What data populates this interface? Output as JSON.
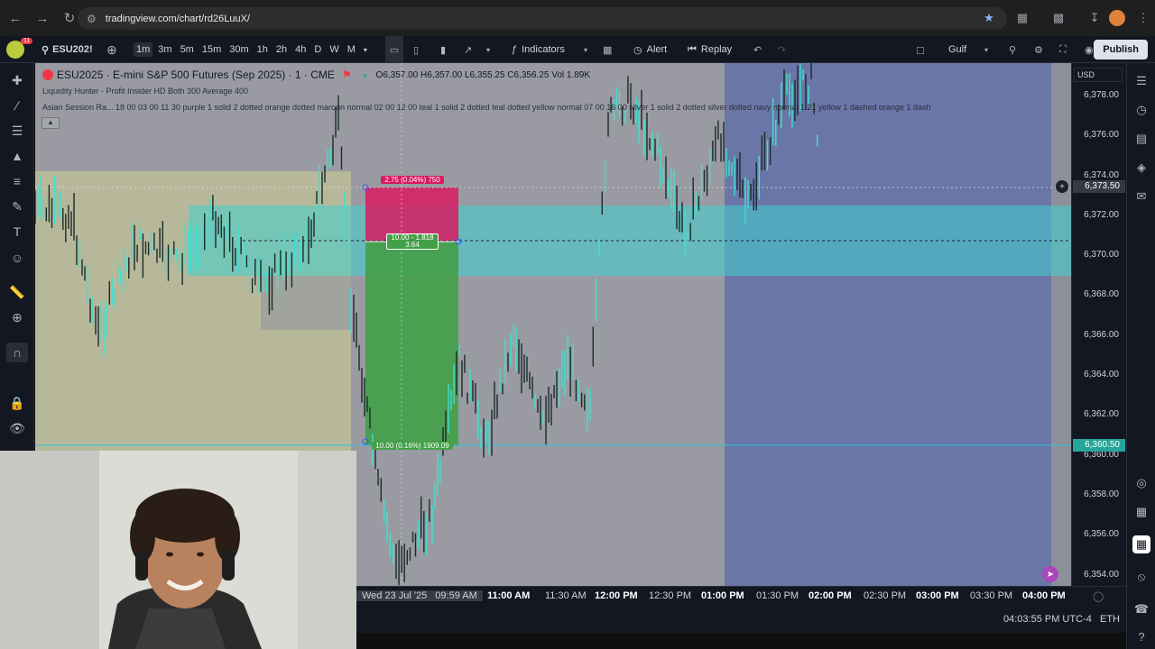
{
  "browser": {
    "url": "tradingview.com/chart/rd26LuuX/"
  },
  "toolbar": {
    "badge_count": "11",
    "symbol": "ESU202!",
    "intervals": [
      "1m",
      "3m",
      "5m",
      "15m",
      "30m",
      "1h",
      "2h",
      "4h",
      "D",
      "W",
      "M"
    ],
    "active_interval": "1m",
    "indicators_label": "Indicators",
    "alert_label": "Alert",
    "replay_label": "Replay",
    "layout_name": "Gulf",
    "publish_label": "Publish"
  },
  "chart": {
    "title": "ESU2025 · E-mini S&P 500 Futures (Sep 2025) · 1 · CME",
    "o_label": "O",
    "o_value": "6,357.00",
    "h_label": "H",
    "h_value": "6,357.00",
    "l_label": "L",
    "l_value": "6,355.25",
    "c_label": "C",
    "c_value": "6,356.25",
    "vol_label": "Vol",
    "vol_value": "1.89K",
    "indicator_1": "Liquidity Hunter - Profit Insider HD Both 300 Average 400",
    "indicator_2": "Asian Session Ra... 18 00 03 00 11 30 purple 1 solid 2 dotted orange dotted maroon normal 02 00 12 00 teal 1 solid 2 dotted teal dotted yellow normal 07 00 16 00 silver 1 solid 2 dotted silver dotted navy normal 1 21 yellow 1 dashed orange 1 dash",
    "currency": "USD",
    "stop_label": "2.75 (0.04%) 750",
    "entry_label_1": "10.00 - 1.818",
    "entry_label_2": "3.64",
    "target_label": "10.00 (0.16%) 1909.09",
    "current_price": "6,360.50",
    "crosshair_price": "6,373.50"
  },
  "price_axis": [
    "6,378.00",
    "6,376.00",
    "6,374.00",
    "6,372.00",
    "6,370.00",
    "6,368.00",
    "6,366.00",
    "6,364.00",
    "6,362.00",
    "6,360.00",
    "6,358.00",
    "6,356.00",
    "6,354.00"
  ],
  "time_axis": {
    "crosshair_date": "Wed 23 Jul '25",
    "crosshair_time": "09:59 AM",
    "labels": [
      "11:00 AM",
      "11:30 AM",
      "12:00 PM",
      "12:30 PM",
      "01:00 PM",
      "01:30 PM",
      "02:00 PM",
      "02:30 PM",
      "03:00 PM",
      "03:30 PM",
      "04:00 PM"
    ]
  },
  "status": {
    "clock": "04:03:55 PM UTC-4",
    "session": "ETH"
  },
  "colors": {
    "chart_bg": "#9a9ba2",
    "candle": "#3fe0d0",
    "stop_zone": "#d81b60",
    "target_zone": "#43a047",
    "current_price_bg": "#26a69a",
    "afternoon_zone": "#6b76a8"
  }
}
